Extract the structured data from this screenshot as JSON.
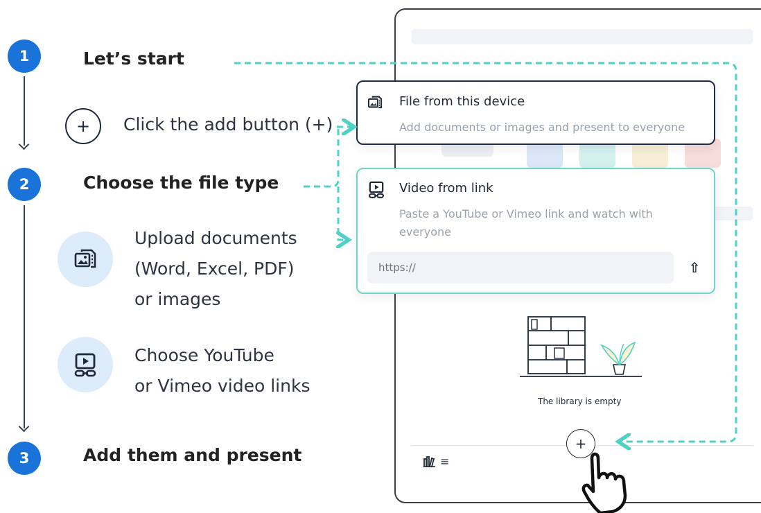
{
  "steps": [
    {
      "number": "1",
      "title": "Let’s start"
    },
    {
      "number": "2",
      "title": "Choose the file type"
    },
    {
      "number": "3",
      "title": "Add them and present"
    }
  ],
  "step1": {
    "plus_symbol": "+",
    "hint": "Click the add button (+)"
  },
  "step2": {
    "upload_lines": [
      "Upload documents",
      "(Word, Excel, PDF)",
      "or images"
    ],
    "video_lines": [
      "Choose YouTube",
      "or Vimeo video links"
    ]
  },
  "cards": {
    "file": {
      "title": "File from this device",
      "description": "Add documents or images and present to everyone"
    },
    "video": {
      "title": "Video from link",
      "description": "Paste a YouTube or Vimeo link and watch with everyone",
      "url_placeholder": "https://",
      "submit_symbol": "⇧"
    }
  },
  "device": {
    "empty_text": "The library is empty",
    "add_symbol": "+",
    "menu_symbol": "≡"
  },
  "colors": {
    "step_badge": "#1a73d8",
    "accent_teal": "#4fd1c5",
    "icon_disc": "#dcecfb",
    "card_border_dark": "#1f2a44"
  }
}
